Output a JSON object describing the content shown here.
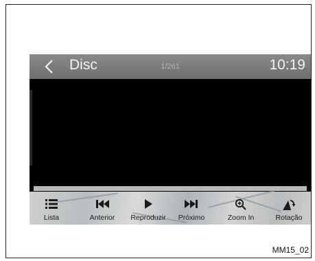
{
  "header": {
    "title": "Disc",
    "counter": "1/261",
    "time": "10:19"
  },
  "toolbar": {
    "buttons": [
      {
        "label": "Lista",
        "icon": "list-icon"
      },
      {
        "label": "Anterior",
        "icon": "skip-previous-icon"
      },
      {
        "label": "Reproduzir",
        "icon": "play-icon"
      },
      {
        "label": "Próximo",
        "icon": "skip-next-icon"
      },
      {
        "label": "Zoom In",
        "icon": "zoom-in-icon"
      },
      {
        "label": "Rotação",
        "icon": "rotate-icon"
      }
    ]
  },
  "figure_code": "MM15_02"
}
